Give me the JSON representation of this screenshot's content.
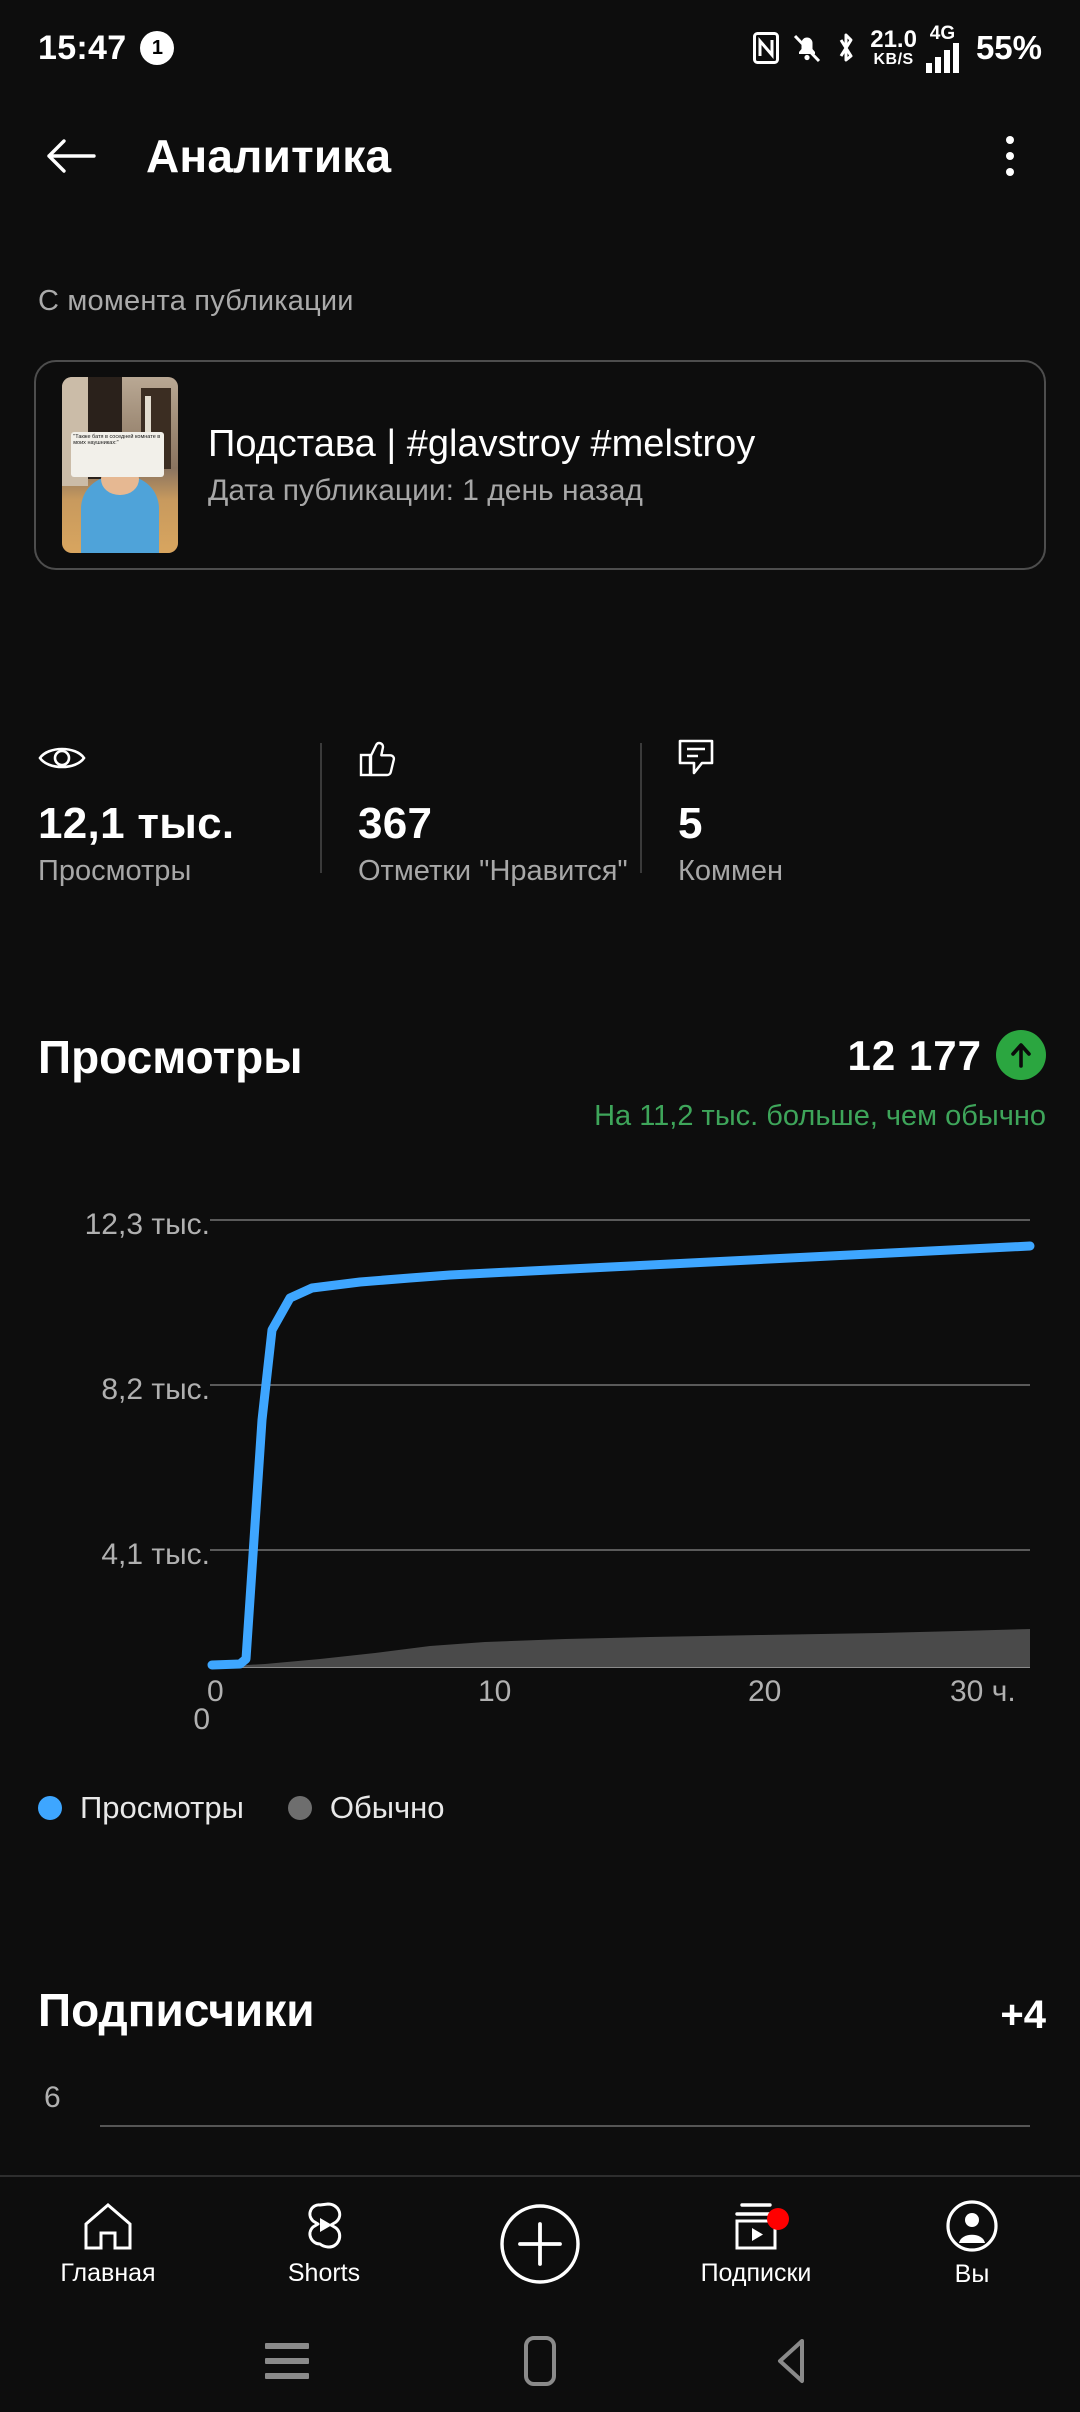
{
  "status_bar": {
    "time": "15:47",
    "notification_count": "1",
    "icons": [
      "nfc-icon",
      "bell-muted-icon",
      "bluetooth-icon"
    ],
    "net_speed_value": "21.0",
    "net_speed_unit": "KB/S",
    "network_type": "4G",
    "battery": "55%"
  },
  "app_bar": {
    "back_icon": "arrow-left-icon",
    "title": "Аналитика",
    "menu_icon": "overflow-menu-icon"
  },
  "section": {
    "since_label": "С момента публикации"
  },
  "video_card": {
    "title": "Подстава | #glavstroy #melstroy",
    "date": "Дата публикации: 1 день назад",
    "thumbnail_caption": "\"Также батя в соседней комнате в моих наушниках:\""
  },
  "stats": [
    {
      "icon": "eye-icon",
      "value": "12,1 тыс.",
      "label": "Просмотры"
    },
    {
      "icon": "thumbs-up-icon",
      "value": "367",
      "label": "Отметки \"Нравится\""
    },
    {
      "icon": "comment-icon",
      "value": "5",
      "label": "Коммен"
    }
  ],
  "views_section": {
    "title": "Просмотры",
    "total": "12 177",
    "trend_icon": "arrow-up-icon",
    "trend_color": "#2ba640",
    "comparison": "На 11,2 тыс. больше, чем обычно"
  },
  "legend": [
    {
      "label": "Просмотры",
      "color": "#3ea6ff"
    },
    {
      "label": "Обычно",
      "color": "#6e6e6e"
    }
  ],
  "subscribers_section": {
    "title": "Подписчики",
    "delta": "+4",
    "y_label_partial": "6"
  },
  "bottom_nav": [
    {
      "icon": "home-icon",
      "label": "Главная"
    },
    {
      "icon": "shorts-icon",
      "label": "Shorts"
    },
    {
      "icon": "create-plus-icon",
      "label": ""
    },
    {
      "icon": "subscriptions-icon",
      "label": "Подписки",
      "badge": true
    },
    {
      "icon": "account-avatar-icon",
      "label": "Вы"
    }
  ],
  "android_nav": [
    {
      "icon": "recents-icon"
    },
    {
      "icon": "home-pill-icon"
    },
    {
      "icon": "back-triangle-icon"
    }
  ],
  "chart_data": {
    "type": "area",
    "title": "Просмотры",
    "xlabel": "",
    "ylabel": "",
    "grid": true,
    "legend_position": "bottom-left",
    "x_tick_labels": [
      "0",
      "10",
      "20",
      "30 ч."
    ],
    "x_ticks": [
      0,
      10,
      20,
      30
    ],
    "y_tick_labels": [
      "0",
      "4,1 тыс.",
      "8,2 тыс.",
      "12,3 тыс."
    ],
    "y_ticks": [
      0,
      4100,
      8200,
      12300
    ],
    "xlim": [
      0,
      30
    ],
    "ylim": [
      0,
      12300
    ],
    "series": [
      {
        "name": "Просмотры",
        "color": "#3ea6ff",
        "style": "line",
        "x": [
          0,
          0.4,
          1.0,
          1.6,
          2.2,
          3.0,
          4.0,
          6.0,
          8.0,
          10.0,
          13.0,
          16.0,
          20.0,
          24.0,
          27.0,
          30.0
        ],
        "values": [
          0,
          120,
          6200,
          10250,
          11050,
          11350,
          11500,
          11620,
          11700,
          11760,
          11840,
          11910,
          11990,
          12060,
          12120,
          12177
        ]
      },
      {
        "name": "Обычно",
        "color": "#6e6e6e",
        "style": "area",
        "x": [
          0,
          2,
          4,
          6,
          8,
          10,
          13,
          16,
          20,
          24,
          27,
          30
        ],
        "values": [
          0,
          90,
          200,
          330,
          560,
          640,
          700,
          740,
          780,
          820,
          860,
          900
        ]
      }
    ]
  }
}
